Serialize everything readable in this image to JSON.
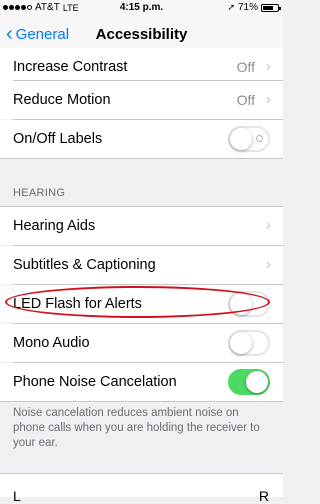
{
  "status_bar": {
    "carrier": "AT&T",
    "network": "LTE",
    "time": "4:15 p.m.",
    "battery": "71%",
    "battery_level": 0.71,
    "location_icon": "location-arrow-icon"
  },
  "nav": {
    "back_label": "General",
    "title": "Accessibility"
  },
  "rows_top": [
    {
      "label": "Increase Contrast",
      "value": "Off"
    },
    {
      "label": "Reduce Motion",
      "value": "Off"
    },
    {
      "label": "On/Off Labels",
      "toggle": false
    }
  ],
  "hearing": {
    "header": "HEARING",
    "rows": [
      {
        "label": "Hearing Aids"
      },
      {
        "label": "Subtitles & Captioning"
      },
      {
        "label": "LED Flash for Alerts",
        "toggle": false
      },
      {
        "label": "Mono Audio",
        "toggle": false
      },
      {
        "label": "Phone Noise Cancelation",
        "toggle": true
      }
    ],
    "footer": "Noise cancelation reduces ambient noise on phone calls when you are holding the receiver to your ear."
  },
  "next_row": {
    "left": "L",
    "right": "R"
  },
  "colors": {
    "accent": "#007aff",
    "toggle_on": "#4cd964",
    "annotation": "#d0121b"
  }
}
